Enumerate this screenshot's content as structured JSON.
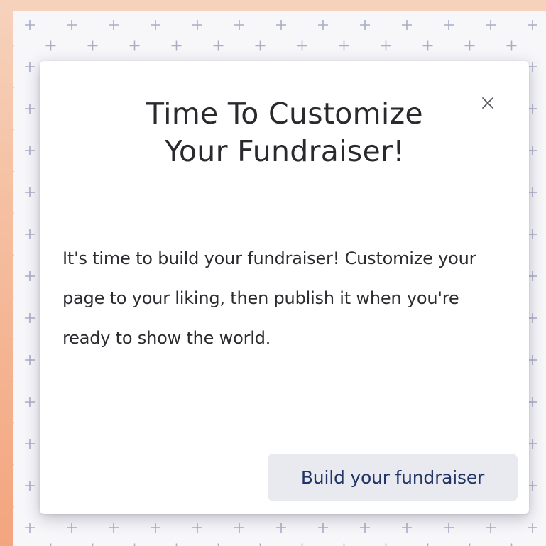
{
  "modal": {
    "title_line1": "Time To Customize",
    "title_line2": "Your Fundraiser!",
    "body": "It's time to build your fundraiser! Customize your page to your liking, then publish it when you're ready to show the world.",
    "close_label": "×",
    "primary_button_label": "Build your fundraiser"
  },
  "icons": {
    "close": "close-icon",
    "background_pattern": "plus-pattern"
  },
  "colors": {
    "outer_background_top": "#f6d2bd",
    "outer_background_bottom": "#f3a57e",
    "pattern_background": "#f7f7fa",
    "pattern_plus": "#a9aec6",
    "modal_background": "#ffffff",
    "title_text": "#2a2a2e",
    "button_background": "#e8eaf0",
    "button_text": "#223366"
  }
}
